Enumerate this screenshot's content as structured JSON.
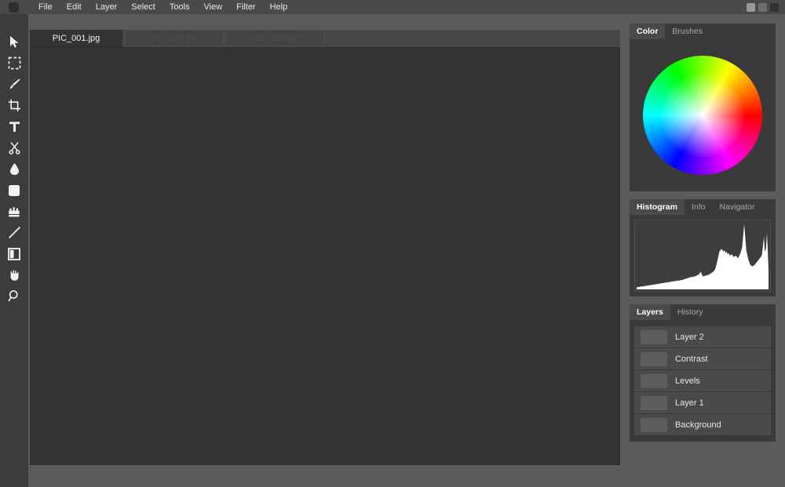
{
  "app": {
    "icon": "app-logo-icon"
  },
  "menubar": {
    "items": [
      {
        "label": "File"
      },
      {
        "label": "Edit"
      },
      {
        "label": "Layer"
      },
      {
        "label": "Select"
      },
      {
        "label": "Tools"
      },
      {
        "label": "View"
      },
      {
        "label": "Filter"
      },
      {
        "label": "Help"
      }
    ],
    "window_controls": [
      {
        "name": "minimize-button"
      },
      {
        "name": "maximize-button"
      },
      {
        "name": "close-button"
      }
    ]
  },
  "toolbar": {
    "tools": [
      {
        "name": "move-tool",
        "icon": "cursor-arrow-icon"
      },
      {
        "name": "marquee-select-tool",
        "icon": "dashed-rectangle-icon"
      },
      {
        "name": "brush-tool",
        "icon": "paintbrush-icon"
      },
      {
        "name": "crop-tool",
        "icon": "crop-icon"
      },
      {
        "name": "text-tool",
        "icon": "text-t-icon"
      },
      {
        "name": "cut-tool",
        "icon": "scissors-icon"
      },
      {
        "name": "blur-tool",
        "icon": "droplet-icon"
      },
      {
        "name": "shape-tool",
        "icon": "rounded-square-icon"
      },
      {
        "name": "stamp-tool",
        "icon": "stamp-icon"
      },
      {
        "name": "line-tool",
        "icon": "diagonal-line-icon"
      },
      {
        "name": "gradient-tool",
        "icon": "half-filled-square-icon"
      },
      {
        "name": "hand-tool",
        "icon": "hand-icon"
      },
      {
        "name": "zoom-tool",
        "icon": "magnifier-icon"
      }
    ]
  },
  "document_tabs": [
    {
      "label": "PIC_001.jpg",
      "active": true
    },
    {
      "label": "PIC_002.jpg",
      "active": false
    },
    {
      "label": "PIC_003.jpg",
      "active": false
    }
  ],
  "panels": {
    "color": {
      "tabs": [
        {
          "label": "Color",
          "active": true
        },
        {
          "label": "Brushes",
          "active": false
        }
      ],
      "wheel_name": "color-wheel"
    },
    "histogram": {
      "tabs": [
        {
          "label": "Histogram",
          "active": true
        },
        {
          "label": "Info",
          "active": false
        },
        {
          "label": "Navigator",
          "active": false
        }
      ]
    },
    "layers": {
      "tabs": [
        {
          "label": "Layers",
          "active": true
        },
        {
          "label": "History",
          "active": false
        }
      ],
      "rows": [
        {
          "name": "Layer 2"
        },
        {
          "name": "Contrast"
        },
        {
          "name": "Levels"
        },
        {
          "name": "Layer 1"
        },
        {
          "name": "Background"
        }
      ]
    }
  },
  "chart_data": {
    "type": "area",
    "title": "Histogram",
    "xlabel": "",
    "ylabel": "",
    "xlim": [
      0,
      255
    ],
    "ylim": [
      0,
      100
    ],
    "grid": false,
    "legend": "none",
    "fill_color": "#ffffff",
    "background": "#3d3d3d",
    "x": [
      0,
      8,
      16,
      24,
      32,
      40,
      48,
      56,
      64,
      72,
      80,
      88,
      96,
      104,
      112,
      120,
      124,
      128,
      132,
      136,
      140,
      144,
      148,
      152,
      156,
      160,
      164,
      168,
      170,
      172,
      174,
      176,
      178,
      180,
      184,
      188,
      192,
      196,
      200,
      204,
      208,
      212,
      216,
      220,
      224,
      228,
      232,
      234,
      236,
      238,
      240,
      242,
      244,
      246,
      248,
      250,
      252,
      255
    ],
    "values": [
      3,
      4,
      5,
      6,
      7,
      8,
      9,
      10,
      11,
      12,
      13,
      14,
      16,
      18,
      19,
      22,
      26,
      19,
      20,
      21,
      22,
      24,
      26,
      30,
      42,
      56,
      60,
      56,
      58,
      54,
      56,
      52,
      54,
      50,
      52,
      48,
      50,
      46,
      52,
      62,
      97,
      58,
      44,
      36,
      34,
      36,
      40,
      42,
      44,
      46,
      48,
      50,
      62,
      78,
      56,
      60,
      84,
      30
    ]
  }
}
